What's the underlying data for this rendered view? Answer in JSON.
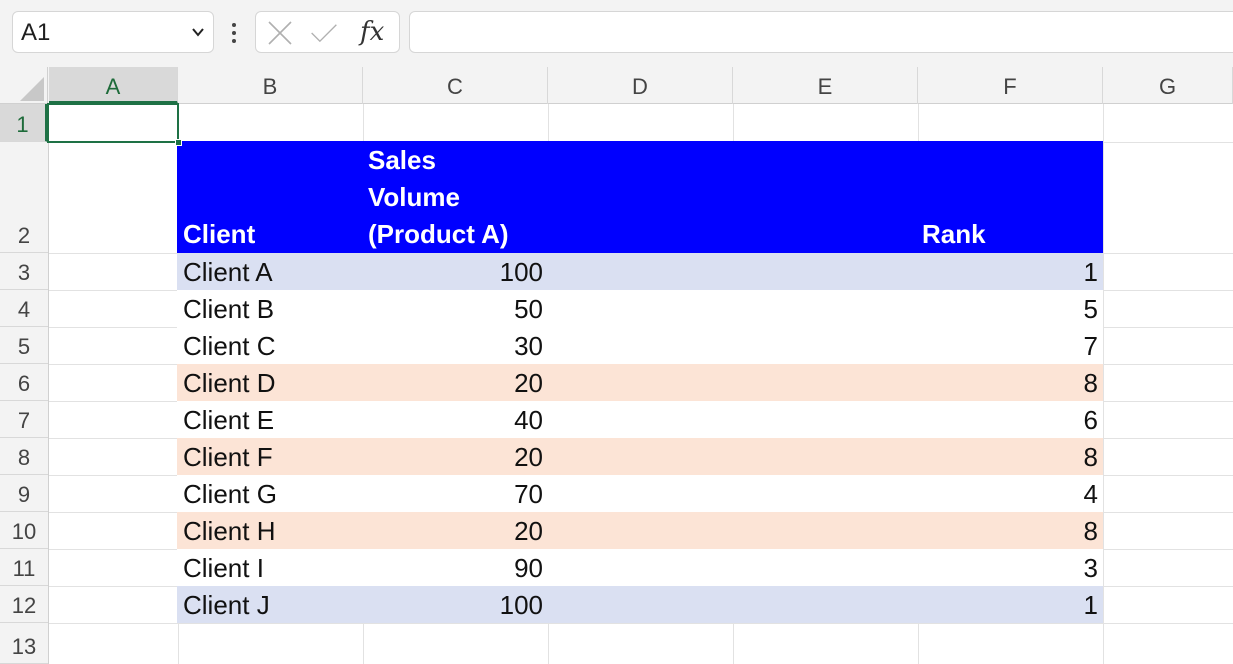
{
  "formula_bar": {
    "name_box": "A1",
    "fx_label": "fx",
    "formula": ""
  },
  "columns": [
    "A",
    "B",
    "C",
    "D",
    "E",
    "F",
    "G"
  ],
  "active_column": "A",
  "rows": [
    "1",
    "2",
    "3",
    "4",
    "5",
    "6",
    "7",
    "8",
    "9",
    "10",
    "11",
    "12",
    "13"
  ],
  "active_row": "1",
  "table": {
    "headers": {
      "client": "Client",
      "sales_line1": "Sales",
      "sales_line2": "Volume",
      "sales_line3": "(Product A)",
      "rank": "Rank"
    },
    "header_color": "#0000ff",
    "rows": [
      {
        "client": "Client A",
        "sales": "100",
        "rank": "1",
        "fill": "#dae0f2"
      },
      {
        "client": "Client B",
        "sales": "50",
        "rank": "5",
        "fill": "#ffffff"
      },
      {
        "client": "Client C",
        "sales": "30",
        "rank": "7",
        "fill": "#ffffff"
      },
      {
        "client": "Client D",
        "sales": "20",
        "rank": "8",
        "fill": "#fce4d6"
      },
      {
        "client": "Client E",
        "sales": "40",
        "rank": "6",
        "fill": "#ffffff"
      },
      {
        "client": "Client F",
        "sales": "20",
        "rank": "8",
        "fill": "#fce4d6"
      },
      {
        "client": "Client G",
        "sales": "70",
        "rank": "4",
        "fill": "#ffffff"
      },
      {
        "client": "Client H",
        "sales": "20",
        "rank": "8",
        "fill": "#fce4d6"
      },
      {
        "client": "Client I",
        "sales": "90",
        "rank": "3",
        "fill": "#ffffff"
      },
      {
        "client": "Client J",
        "sales": "100",
        "rank": "1",
        "fill": "#dae0f2"
      }
    ]
  }
}
